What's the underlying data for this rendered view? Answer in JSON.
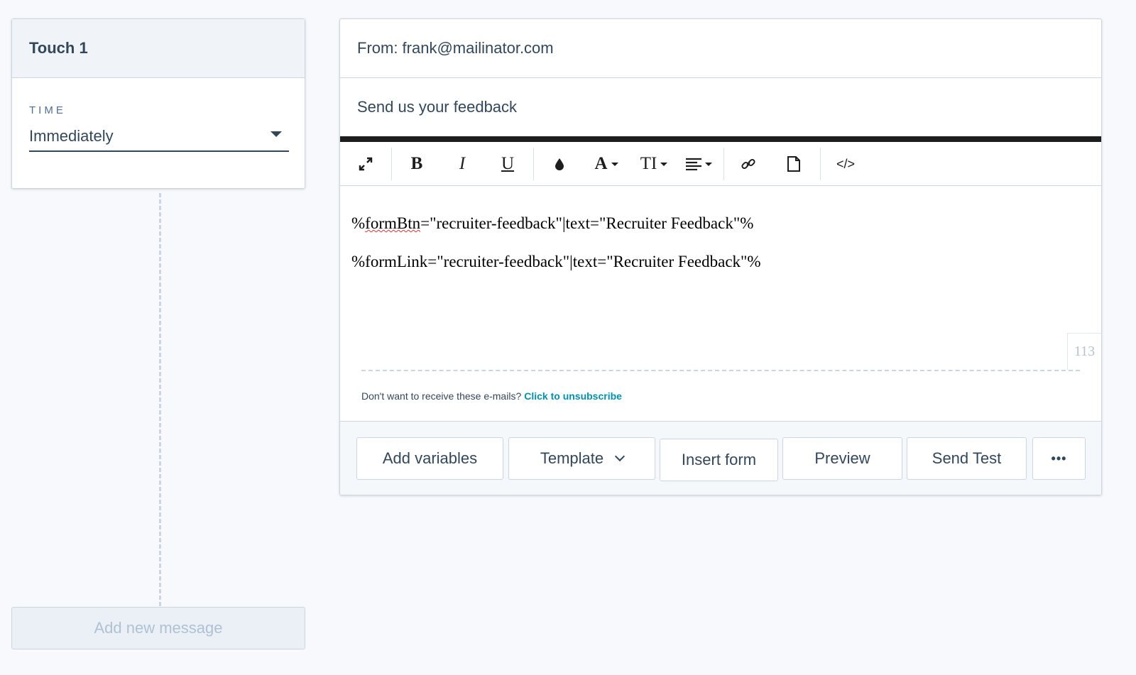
{
  "touch": {
    "title": "Touch 1",
    "time_label": "TIME",
    "time_value": "Immediately"
  },
  "add_message_label": "Add new message",
  "email": {
    "from": "From: frank@mailinator.com",
    "subject": "Send us your feedback",
    "content": {
      "line1_pre": "%",
      "line1_misspelled": "formBtn",
      "line1_post": "=\"recruiter-feedback\"|text=\"Recruiter Feedback\"%",
      "line2": "%formLink=\"recruiter-feedback\"|text=\"Recruiter Feedback\"%"
    },
    "char_count": "113",
    "footer_text": "Don't want to receive these e-mails?",
    "unsubscribe_link": "Click to unsubscribe"
  },
  "toolbar": {
    "icons": [
      "expand-icon",
      "bold-icon",
      "italic-icon",
      "underline-icon",
      "color-drop-icon",
      "font-icon",
      "text-size-icon",
      "align-icon",
      "link-icon",
      "file-icon",
      "code-icon"
    ],
    "bold": "B",
    "italic": "I",
    "underline": "U",
    "font": "A",
    "size": "TI",
    "code": "</>"
  },
  "actions": {
    "add_variables": "Add variables",
    "template": "Template",
    "insert_form": "Insert form",
    "preview": "Preview",
    "send_test": "Send Test",
    "more": "•••"
  },
  "colors": {
    "text": "#33475b",
    "border": "#cbd6e2",
    "link": "#0091ae",
    "background": "#f7f9fc"
  }
}
